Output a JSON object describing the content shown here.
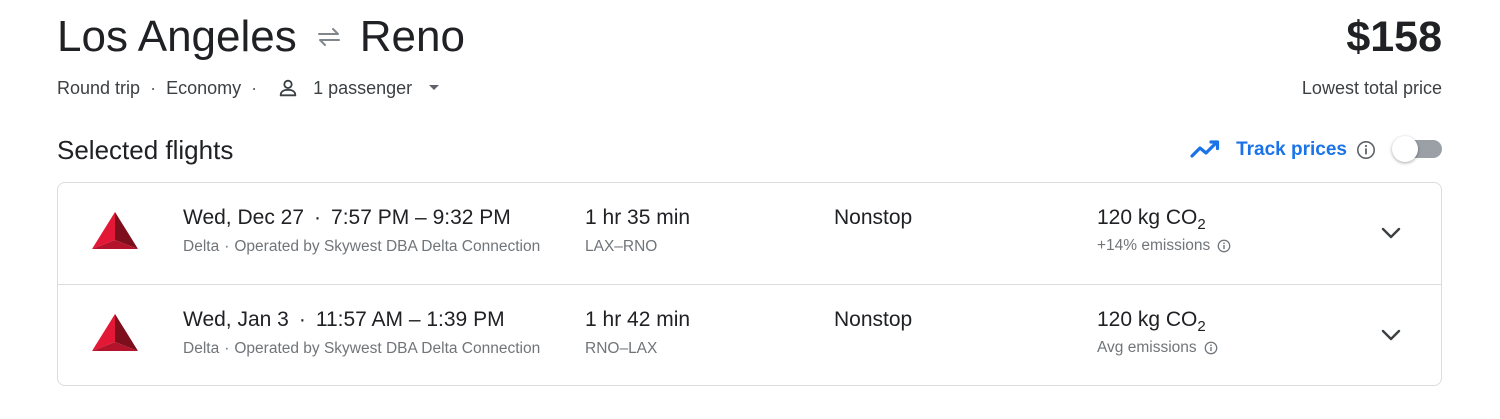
{
  "header": {
    "origin": "Los Angeles",
    "destination": "Reno",
    "swap_icon": "swap-horizontal-icon",
    "price": "$158",
    "price_caption": "Lowest total price"
  },
  "options": {
    "trip_type": "Round trip",
    "cabin": "Economy",
    "passengers": "1 passenger",
    "separator": "·"
  },
  "section": {
    "title": "Selected flights",
    "track_prices_label": "Track prices",
    "track_prices_enabled": false
  },
  "colors": {
    "accent": "#1a73e8",
    "delta_red": "#c8102e",
    "border": "#dadce0",
    "secondary_text": "#70757a"
  },
  "flights": [
    {
      "date": "Wed, Dec 27",
      "time_range": "7:57 PM – 9:32 PM",
      "airline": "Delta",
      "operator": "Operated by Skywest DBA Delta Connection",
      "duration": "1 hr 35 min",
      "airports": "LAX–RNO",
      "stops": "Nonstop",
      "co2_value": "120 kg CO",
      "co2_sub": "2",
      "emissions": "+14% emissions"
    },
    {
      "date": "Wed, Jan 3",
      "time_range": "11:57 AM – 1:39 PM",
      "airline": "Delta",
      "operator": "Operated by Skywest DBA Delta Connection",
      "duration": "1 hr 42 min",
      "airports": "RNO–LAX",
      "stops": "Nonstop",
      "co2_value": "120 kg CO",
      "co2_sub": "2",
      "emissions": "Avg emissions"
    }
  ]
}
